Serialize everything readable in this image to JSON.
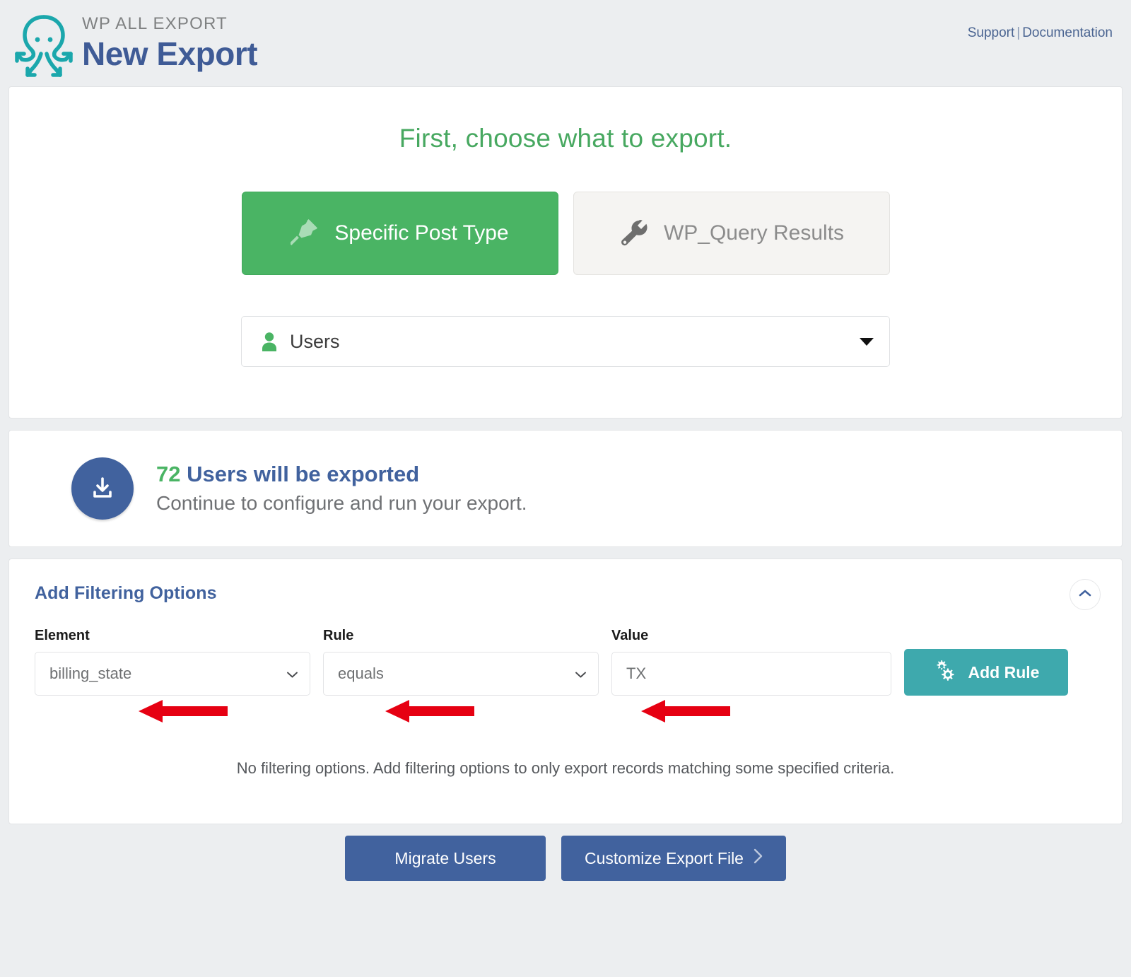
{
  "header": {
    "brand_small": "WP ALL EXPORT",
    "brand_big": "New Export",
    "logo_icon": "octopus-logo-icon",
    "links": {
      "support": "Support",
      "separator": "|",
      "documentation": "Documentation"
    }
  },
  "choose": {
    "title": "First, choose what to export.",
    "options": [
      {
        "label": "Specific Post Type",
        "icon": "pin-icon",
        "active": true
      },
      {
        "label": "WP_Query Results",
        "icon": "wrench-icon",
        "active": false
      }
    ],
    "post_type_select": {
      "value": "Users",
      "icon": "user-icon",
      "caret": "caret-down-icon"
    }
  },
  "status": {
    "icon": "download-icon",
    "count": "72",
    "headline_rest": " Users will be exported",
    "subline": "Continue to configure and run your export."
  },
  "filter": {
    "title": "Add Filtering Options",
    "collapse_icon": "chevron-up-icon",
    "labels": {
      "element": "Element",
      "rule": "Rule",
      "value": "Value"
    },
    "element_value": "billing_state",
    "rule_value": "equals",
    "value_value": "TX",
    "add_rule_label": "Add Rule",
    "add_rule_icon": "gears-icon",
    "empty_message": "No filtering options. Add filtering options to only export records matching some specified criteria."
  },
  "footer": {
    "migrate_label": "Migrate Users",
    "customize_label": "Customize Export File",
    "customize_icon": "chevron-right-icon"
  },
  "annotations": {
    "arrow_color": "#e60012",
    "arrows": [
      {
        "name": "arrow-to-element-field",
        "points_to": "billing_state"
      },
      {
        "name": "arrow-to-rule-field",
        "points_to": "equals"
      },
      {
        "name": "arrow-to-value-field",
        "points_to": "TX"
      }
    ]
  },
  "colors": {
    "green": "#4ab464",
    "blue": "#41629e",
    "teal": "#3ea9ad",
    "logo_teal": "#1ba7ac",
    "page_bg": "#eceef0",
    "red": "#e60012"
  }
}
